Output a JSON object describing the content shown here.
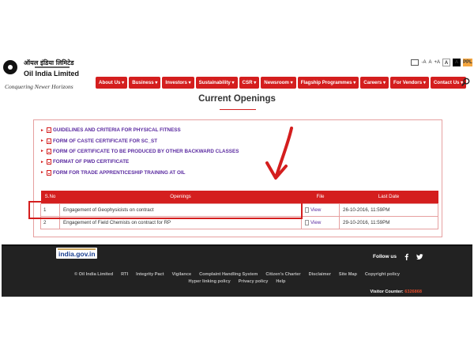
{
  "header": {
    "logo_hindi": "ऑयल इंडिया लिमिटेड",
    "logo_english": "Oil India Limited",
    "tagline": "Conquering Newer Horizons"
  },
  "accessibility": {
    "decrease": "-A",
    "normal": "A",
    "increase": "+A",
    "theme_white": "A",
    "theme_black": "A",
    "theme_orange": "PPL"
  },
  "nav": {
    "items": [
      "About Us",
      "Business",
      "Investors",
      "Sustainability",
      "CSR",
      "Newsroom",
      "Flagship Programmes",
      "Careers",
      "For Vendors",
      "Contact Us"
    ]
  },
  "main": {
    "title": "Current Openings",
    "documents": [
      "GUIDELINES AND CRITERIA FOR PHYSICAL FITNESS",
      "FORM OF CASTE CERTIFICATE FOR SC_ST",
      "FORM OF CERTIFICATE TO BE PRODUCED BY OTHER BACKWARD CLASSES",
      "FORMAT OF PWD CERTIFICATE",
      "FORM FOR TRADE APPRENTICESHIP TRAINING AT OIL"
    ],
    "table": {
      "headers": [
        "S.No",
        "Openings",
        "File",
        "Last Date"
      ],
      "rows": [
        {
          "no": "1",
          "opening": "Engagement of Geophysicists on contract",
          "file": "View",
          "last_date": "26-10-2016, 11:59PM"
        },
        {
          "no": "2",
          "opening": "Engagement of Field Chemists on contract for RP",
          "file": "View",
          "last_date": "29-10-2016, 11:59PM"
        }
      ]
    }
  },
  "footer": {
    "india_gov": "india.gov.in",
    "follow_us": "Follow us",
    "links_row1": [
      "© Oil India Limited",
      "RTI",
      "Integrity Pact",
      "Vigilance",
      "Complaint Handling System",
      "Citizen's Charter",
      "Disclaimer",
      "Site Map",
      "Copyright policy"
    ],
    "links_row2": [
      "Hyper linking policy",
      "Privacy policy",
      "Help"
    ],
    "visitor_label": "Visitor Counter:",
    "visitor_count": "6326868"
  },
  "colors": {
    "brand_red": "#d41e1e",
    "link_purple": "#5a2aa0",
    "footer_bg": "#222222"
  }
}
